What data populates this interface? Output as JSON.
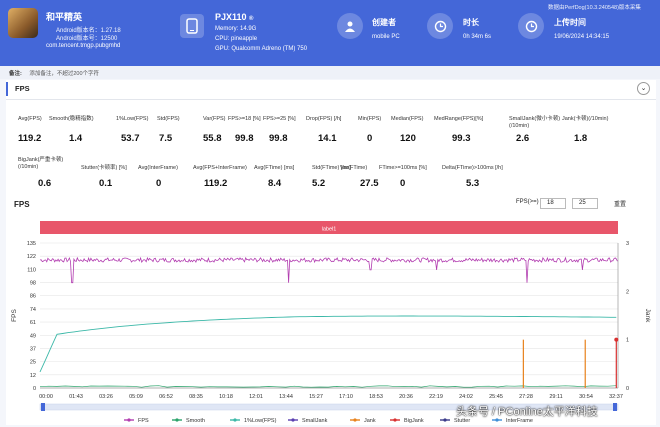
{
  "app": {
    "name": "和平精英",
    "version_line": "Android版本名：1.27.18",
    "code_line": "Android版本号：12500",
    "package": "com.tencent.tmgp.pubgmhd"
  },
  "device": {
    "name": "PJX110",
    "badge": "®",
    "memory": "Memory: 14.9G",
    "cpu": "CPU: pineapple",
    "gpu": "GPU: Qualcomm Adreno (TM) 750"
  },
  "creator": {
    "label": "创建者",
    "value": "mobile PC"
  },
  "duration": {
    "label": "时长",
    "value": "0h 34m 6s"
  },
  "upload": {
    "label": "上传时间",
    "value": "19/06/2024 14:34:15"
  },
  "brand_note": "数据由PerfDog(10.3.240548)版本采集",
  "note": {
    "label": "备注:",
    "placeholder": "添加备注，不超过200个字符"
  },
  "section": {
    "title": "FPS",
    "fold_icon": "chevron-down-icon"
  },
  "stats_row1": [
    {
      "label": "Avg(FPS)",
      "value": "119.2"
    },
    {
      "label": "Smooth(稳精指数)",
      "value": "1.4"
    },
    {
      "label": "1%Low(FPS)",
      "value": "53.7"
    },
    {
      "label": "Std(FPS)",
      "value": "7.5"
    },
    {
      "label": "Var(FPS)",
      "value": "55.8"
    },
    {
      "label": "FPS>=18 [%]",
      "value": "99.8"
    },
    {
      "label": "FPS>=25 [%]",
      "value": "99.8"
    },
    {
      "label": "Drop(FPS) [/h]",
      "value": "14.1"
    },
    {
      "label": "Min(FPS)",
      "value": "0"
    },
    {
      "label": "Median(FPS)",
      "value": "120"
    },
    {
      "label": "MedRange(FPS)[%]",
      "value": "99.3"
    },
    {
      "label": "SmallJank(微小卡顿)(/10min)",
      "value": "2.6"
    },
    {
      "label": "Jank(卡顿)(/10min)",
      "value": "1.8"
    }
  ],
  "stats_row2": [
    {
      "label": "BigJank(严重卡顿)(/10min)",
      "value": "0.6"
    },
    {
      "label": "Stutter(卡顿率) [%]",
      "value": "0.1"
    },
    {
      "label": "Avg(InterFrame)",
      "value": "0"
    },
    {
      "label": "Avg(FPS+InterFrame)",
      "value": "119.2"
    },
    {
      "label": "Avg(FTime) [ms]",
      "value": "8.4"
    },
    {
      "label": "Std(FTime) [ms]",
      "value": "5.2"
    },
    {
      "label": "Var(FTime)",
      "value": "27.5"
    },
    {
      "label": "FTime>=100ms [%]",
      "value": "0"
    },
    {
      "label": "Delta(FTime)>100ms [/h]",
      "value": "5.3"
    }
  ],
  "chart_controls": {
    "title": "FPS",
    "fps_label": "FPS(>=)",
    "min_value": "18",
    "max_value": "25",
    "confirm_label": "重置"
  },
  "chart_data": {
    "type": "line",
    "band_label": "label1",
    "ylabel_left": "FPS",
    "ylabel_right": "Jank",
    "y_ticks_left": [
      "0",
      "12",
      "25",
      "37",
      "49",
      "61",
      "74",
      "86",
      "98",
      "110",
      "122",
      "135"
    ],
    "y_ticks_right": [
      "0",
      "1",
      "2",
      "3"
    ],
    "ylim_left": [
      0,
      135
    ],
    "ylim_right": [
      0,
      3
    ],
    "x_ticks": [
      "00:00",
      "01:43",
      "03:26",
      "05:09",
      "06:52",
      "08:35",
      "10:18",
      "12:01",
      "13:44",
      "15:27",
      "17:10",
      "18:53",
      "20:36",
      "22:19",
      "24:02",
      "25:45",
      "27:28",
      "29:11",
      "30:54",
      "32:37"
    ],
    "grid": true,
    "legend_position": "bottom",
    "series": [
      {
        "name": "FPS",
        "color": "#b23db0",
        "level": 119.2
      },
      {
        "name": "Smooth",
        "color": "#2aa36a",
        "level": 1.4
      },
      {
        "name": "1%Low(FPS)",
        "color": "#3cb8a8",
        "level": 70
      },
      {
        "name": "SmallJank",
        "color": "#5a3fb0"
      },
      {
        "name": "Jank",
        "color": "#e8821c"
      },
      {
        "name": "BigJank",
        "color": "#d83030"
      },
      {
        "name": "Stutter",
        "color": "#3a3a8a"
      },
      {
        "name": "InterFrame",
        "color": "#3e8fd8"
      }
    ],
    "fps_dips": [
      {
        "t": "01:54",
        "fps": 98
      },
      {
        "t": "14:41",
        "fps": 98
      },
      {
        "t": "19:30",
        "fps": 110
      },
      {
        "t": "23:23",
        "fps": 110
      },
      {
        "t": "28:44",
        "fps": 98
      },
      {
        "t": "32:00",
        "fps": 110
      }
    ],
    "jank_markers": [
      {
        "t": "28:31",
        "jank": 1
      },
      {
        "t": "32:10",
        "jank": 1
      },
      {
        "t": "34:00",
        "jank": 1
      }
    ]
  },
  "legend": [
    "FPS",
    "Smooth",
    "1%Low(FPS)",
    "SmallJank",
    "Jank",
    "BigJank",
    "Stutter",
    "InterFrame"
  ],
  "watermark": "头条号 / PConline太平洋科技"
}
